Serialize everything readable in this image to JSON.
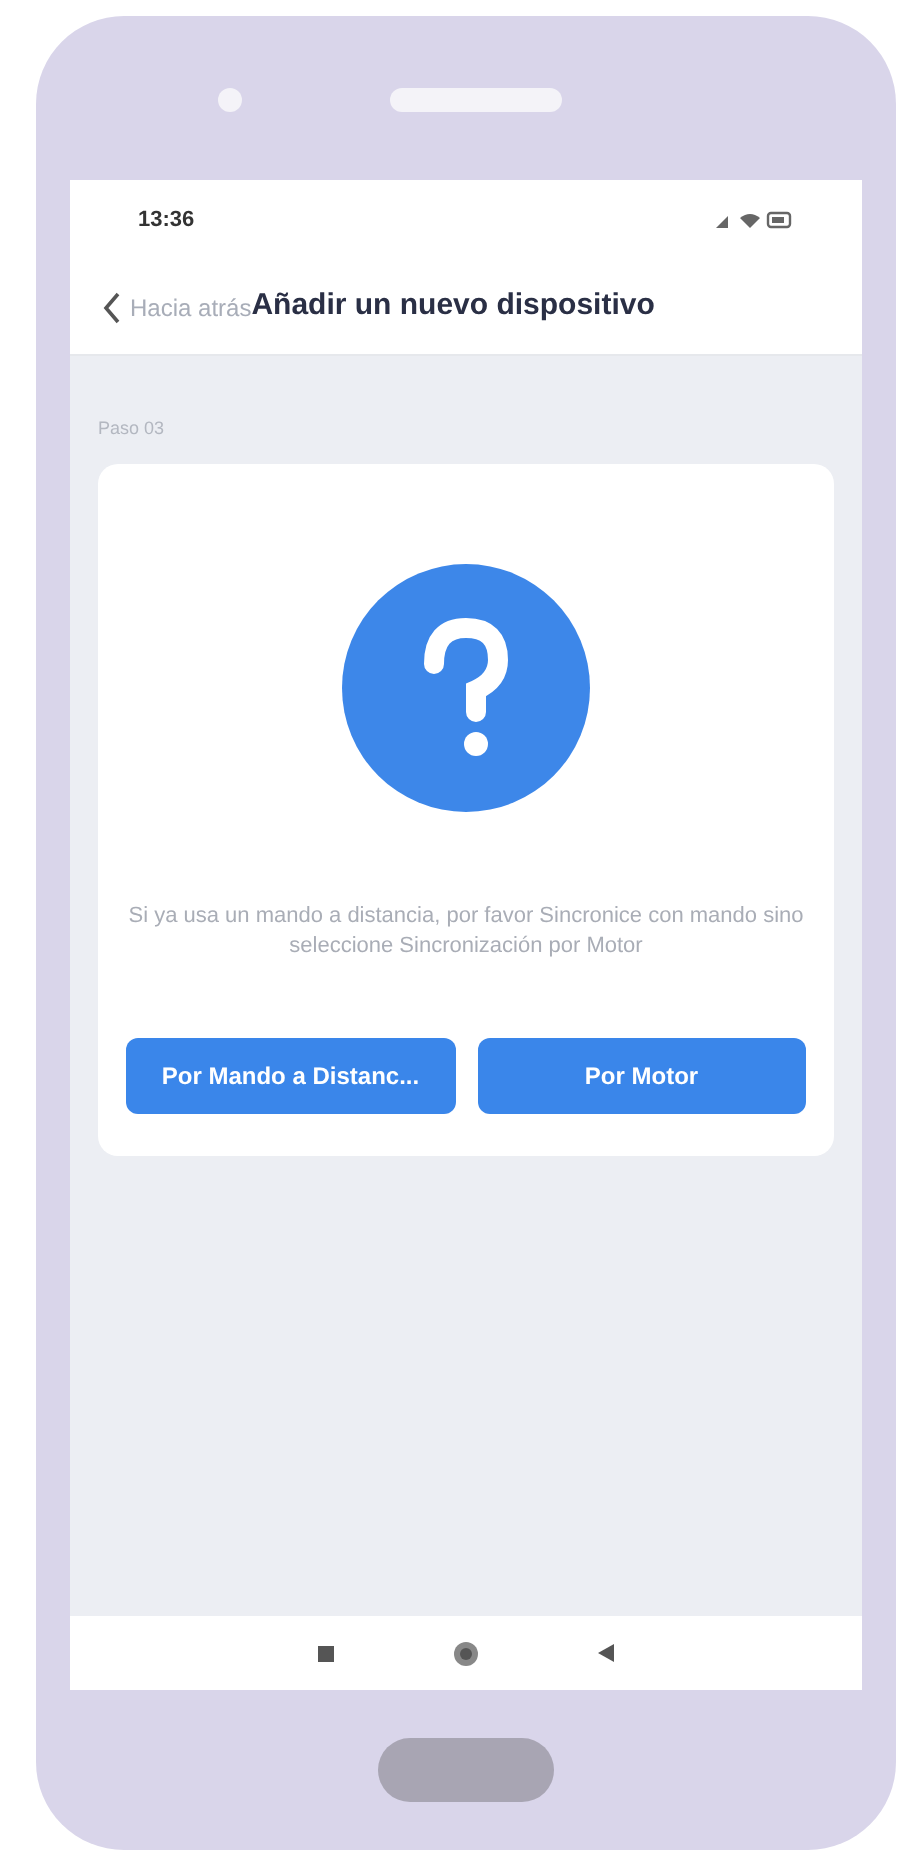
{
  "status_bar": {
    "time": "13:36"
  },
  "header": {
    "back_label": "Hacia atrás",
    "title": "Añadir un nuevo dispositivo"
  },
  "step": "Paso 03",
  "card": {
    "message": "Si ya usa un mando a distancia, por favor Sincronice con mando sino seleccione Sincronización por Motor",
    "buttons": [
      {
        "label": "Por Mando a Distanc..."
      },
      {
        "label": "Por Motor"
      }
    ]
  }
}
